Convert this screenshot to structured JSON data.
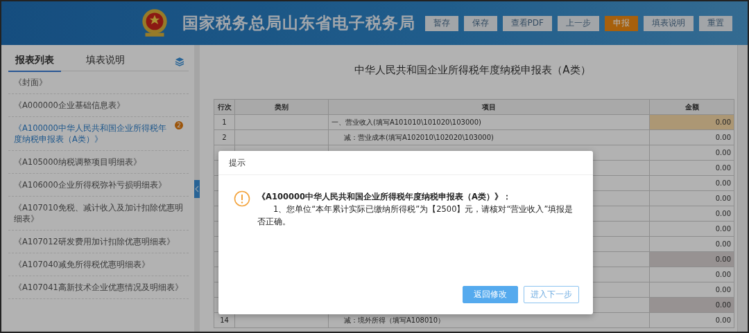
{
  "header": {
    "title": "国家税务总局山东省电子税务局",
    "buttons": [
      {
        "label": "暂存",
        "primary": false
      },
      {
        "label": "保存",
        "primary": false
      },
      {
        "label": "查看PDF",
        "primary": false
      },
      {
        "label": "上一步",
        "primary": false
      },
      {
        "label": "申报",
        "primary": true
      },
      {
        "label": "填表说明",
        "primary": false
      },
      {
        "label": "重置",
        "primary": false
      }
    ]
  },
  "sidebar": {
    "tabs": [
      {
        "label": "报表列表",
        "selected": true
      },
      {
        "label": "填表说明",
        "selected": false
      }
    ],
    "items": [
      {
        "label": "《封面》",
        "selected": false
      },
      {
        "label": "《A000000企业基础信息表》",
        "selected": false
      },
      {
        "label": "《A100000中华人民共和国企业所得税年度纳税申报表（A类）》",
        "selected": true,
        "badge": "2"
      },
      {
        "label": "《A105000纳税调整项目明细表》",
        "selected": false
      },
      {
        "label": "《A106000企业所得税弥补亏损明细表》",
        "selected": false
      },
      {
        "label": "《A107010免税、减计收入及加计扣除优惠明细表》",
        "selected": false
      },
      {
        "label": "《A107012研发费用加计扣除优惠明细表》",
        "selected": false
      },
      {
        "label": "《A107040减免所得税优惠明细表》",
        "selected": false
      },
      {
        "label": "《A107041高新技术企业优惠情况及明细表》",
        "selected": false
      }
    ]
  },
  "form": {
    "title": "中华人民共和国企业所得税年度纳税申报表（A类）",
    "columns": [
      "行次",
      "类别",
      "项目",
      "金额"
    ],
    "rows": [
      {
        "no": "1",
        "item": "一、营业收入(填写A101010\\101020\\103000)",
        "amount": "0.00",
        "focused": true,
        "shaded": false,
        "indent": false
      },
      {
        "no": "2",
        "item": "减：营业成本(填写A102010\\102020\\103000)",
        "amount": "0.00",
        "focused": false,
        "shaded": false,
        "indent": true
      },
      {
        "amount": "0.00",
        "focused": false,
        "shaded": false
      },
      {
        "amount": "0.00",
        "focused": false,
        "shaded": false
      },
      {
        "amount": "0.00",
        "focused": false,
        "shaded": false
      },
      {
        "amount": "0.00",
        "focused": false,
        "shaded": false
      },
      {
        "amount": "0.00",
        "focused": false,
        "shaded": false
      },
      {
        "amount": "0.00",
        "focused": false,
        "shaded": false
      },
      {
        "amount": "0.00",
        "focused": false,
        "shaded": false
      },
      {
        "amount": "0.00",
        "focused": false,
        "shaded": true
      },
      {
        "amount": "0.00",
        "focused": false,
        "shaded": false
      },
      {
        "amount": "0.00",
        "focused": false,
        "shaded": false
      },
      {
        "amount": "0.00",
        "focused": false,
        "shaded": true
      },
      {
        "no": "14",
        "item": "减：境外所得（填写A108010）",
        "amount": "0.00",
        "focused": false,
        "shaded": false,
        "indent": true
      }
    ]
  },
  "dialog": {
    "title": "提示",
    "heading": "《A100000中华人民共和国企业所得税年度纳税申报表（A类）》：",
    "message": "1、您单位“本年累计实际已缴纳所得税”为【2500】元，请核对“营业收入”填报是否正确。",
    "buttons": [
      {
        "label": "返回修改",
        "primary": true
      },
      {
        "label": "进入下一步",
        "primary": false
      }
    ]
  }
}
